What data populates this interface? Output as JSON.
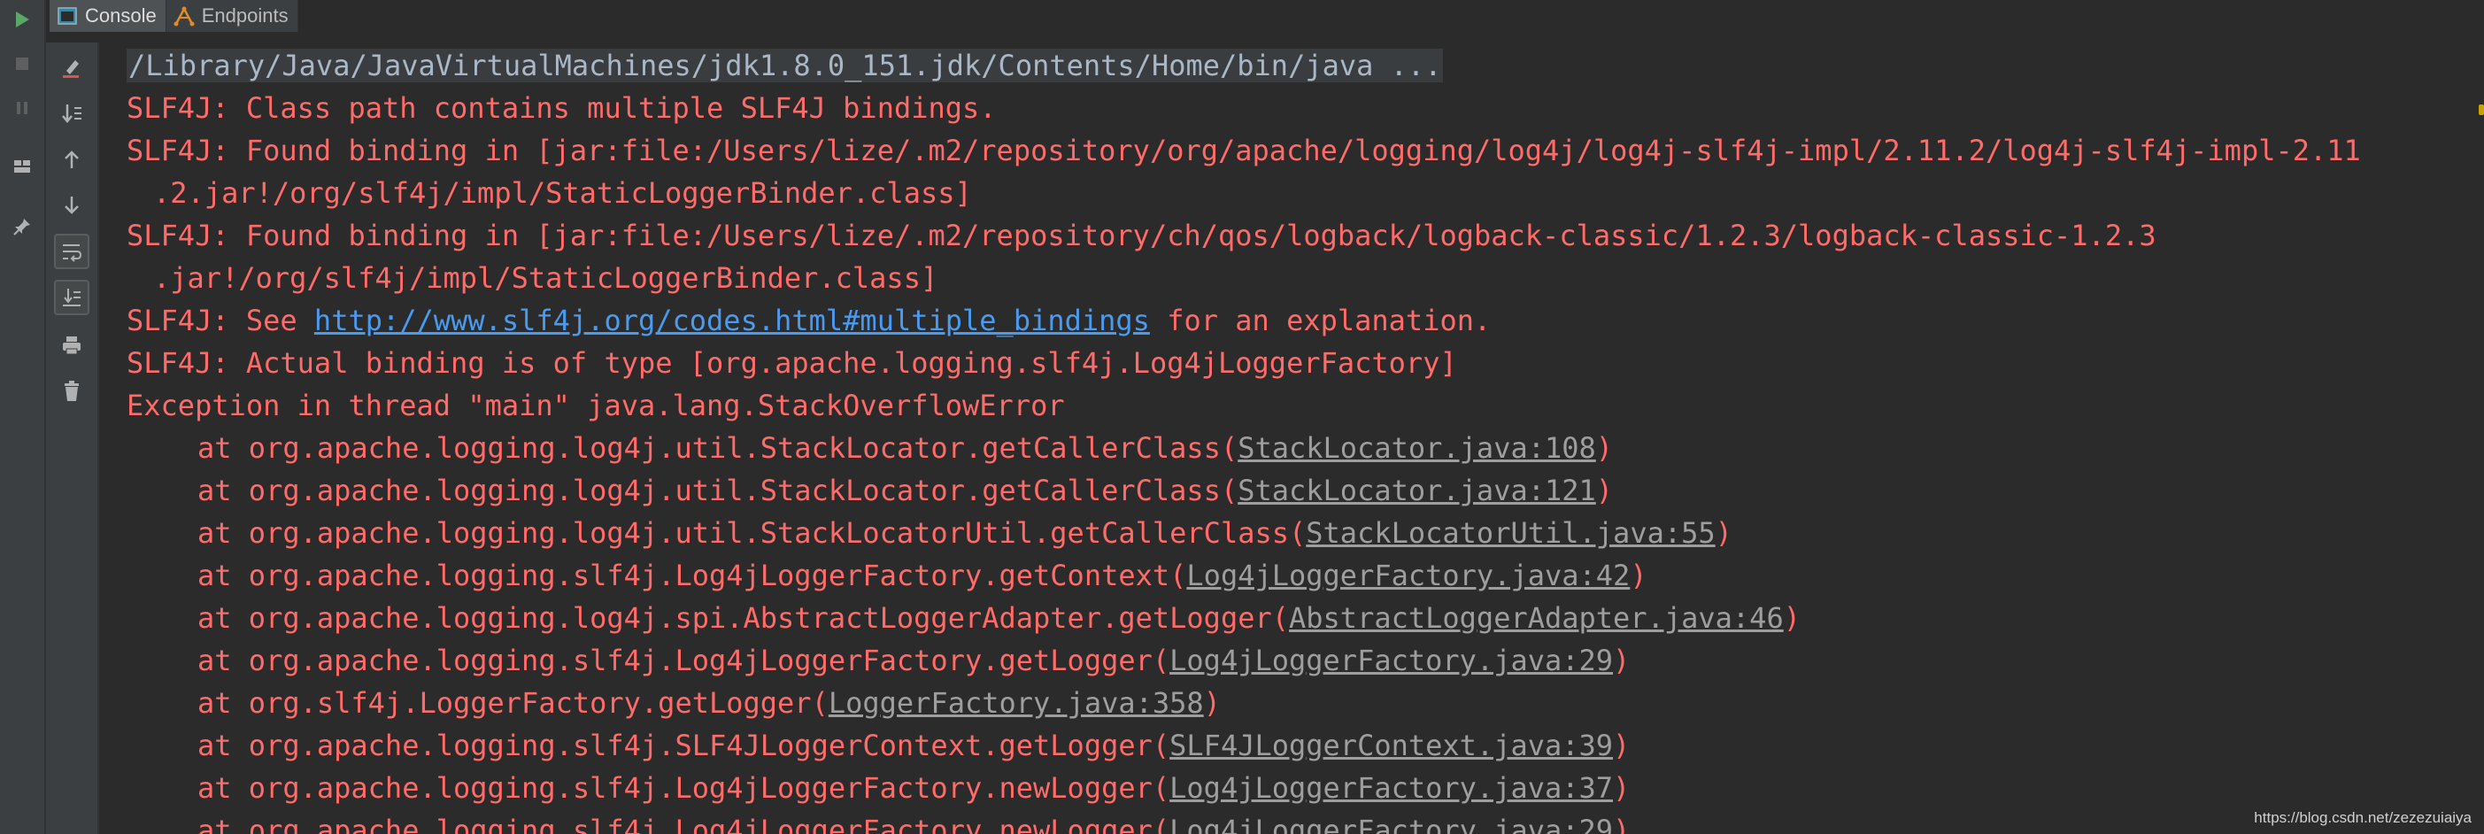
{
  "tabs": [
    {
      "label": "Console",
      "icon": "console-icon",
      "active": true
    },
    {
      "label": "Endpoints",
      "icon": "endpoints-icon",
      "active": false
    }
  ],
  "run_toolbar": [
    "run-icon",
    "stop-icon",
    "pause-icon",
    "layout-icon",
    "pin-icon"
  ],
  "console_toolbar": [
    "clear-icon",
    "scroll-to-stacktrace-icon",
    "up-arrow-icon",
    "down-arrow-icon",
    "soft-wrap-icon",
    "scroll-to-end-icon",
    "print-icon",
    "trash-icon"
  ],
  "colors": {
    "background": "#2b2b2b",
    "error_text": "#ff6b68",
    "command_text": "#a9b7c6",
    "link": "#4a9bf0",
    "source_link": "#9e9e9e",
    "run_green": "#59a869"
  },
  "console": {
    "command": "/Library/Java/JavaVirtualMachines/jdk1.8.0_151.jdk/Contents/Home/bin/java ...",
    "l1": "SLF4J: Class path contains multiple SLF4J bindings.",
    "l2": "SLF4J: Found binding in [jar:file:/Users/lize/.m2/repository/org/apache/logging/log4j/log4j-slf4j-impl/2.11.2/log4j-slf4j-impl-2.11",
    "l2b": ".2.jar!/org/slf4j/impl/StaticLoggerBinder.class]",
    "l3": "SLF4J: Found binding in [jar:file:/Users/lize/.m2/repository/ch/qos/logback/logback-classic/1.2.3/logback-classic-1.2.3",
    "l3b": ".jar!/org/slf4j/impl/StaticLoggerBinder.class]",
    "see_prefix": "SLF4J: See ",
    "see_url": "http://www.slf4j.org/codes.html#multiple_bindings",
    "see_suffix": " for an explanation.",
    "l5": "SLF4J: Actual binding is of type [org.apache.logging.slf4j.Log4jLoggerFactory]",
    "exception": "Exception in thread \"main\" java.lang.StackOverflowError",
    "stack": [
      {
        "prefix": "at org.apache.logging.log4j.util.StackLocator.getCallerClass(",
        "link": "StackLocator.java:108",
        "suffix": ")"
      },
      {
        "prefix": "at org.apache.logging.log4j.util.StackLocator.getCallerClass(",
        "link": "StackLocator.java:121",
        "suffix": ")"
      },
      {
        "prefix": "at org.apache.logging.log4j.util.StackLocatorUtil.getCallerClass(",
        "link": "StackLocatorUtil.java:55",
        "suffix": ")"
      },
      {
        "prefix": "at org.apache.logging.slf4j.Log4jLoggerFactory.getContext(",
        "link": "Log4jLoggerFactory.java:42",
        "suffix": ")"
      },
      {
        "prefix": "at org.apache.logging.log4j.spi.AbstractLoggerAdapter.getLogger(",
        "link": "AbstractLoggerAdapter.java:46",
        "suffix": ")"
      },
      {
        "prefix": "at org.apache.logging.slf4j.Log4jLoggerFactory.getLogger(",
        "link": "Log4jLoggerFactory.java:29",
        "suffix": ")"
      },
      {
        "prefix": "at org.slf4j.LoggerFactory.getLogger(",
        "link": "LoggerFactory.java:358",
        "suffix": ")"
      },
      {
        "prefix": "at org.apache.logging.slf4j.SLF4JLoggerContext.getLogger(",
        "link": "SLF4JLoggerContext.java:39",
        "suffix": ")"
      },
      {
        "prefix": "at org.apache.logging.slf4j.Log4jLoggerFactory.newLogger(",
        "link": "Log4jLoggerFactory.java:37",
        "suffix": ")"
      },
      {
        "prefix": "at org.apache.logging.slf4j.Log4jLoggerFactory.newLogger(",
        "link": "Log4jLoggerFactory.java:29",
        "suffix": ")"
      }
    ]
  },
  "watermark": "https://blog.csdn.net/zezezuiaiya"
}
